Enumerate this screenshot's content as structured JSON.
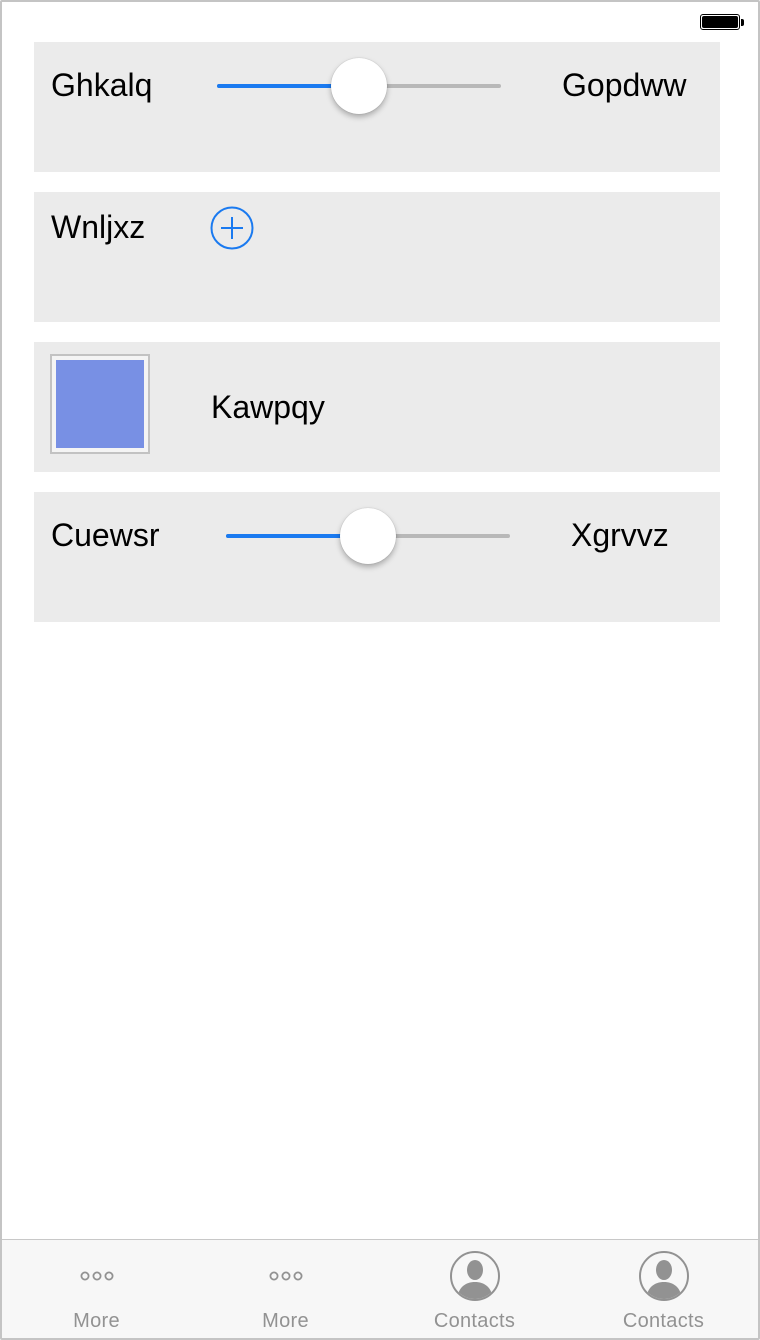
{
  "status_bar": {
    "battery_icon": "battery-full-icon"
  },
  "rows": [
    {
      "type": "slider",
      "min_label": "Ghkalq",
      "max_label": "Gopdww",
      "value": 0.5
    },
    {
      "type": "add",
      "label": "Wnljxz",
      "icon": "plus-circle-icon"
    },
    {
      "type": "color",
      "label": "Kawpqy",
      "color": "#7890e4"
    },
    {
      "type": "slider",
      "min_label": "Cuewsr",
      "max_label": "Xgrvvz",
      "value": 0.5
    }
  ],
  "tab_bar": {
    "items": [
      {
        "label": "More",
        "icon": "more-dots-icon"
      },
      {
        "label": "More",
        "icon": "more-dots-icon"
      },
      {
        "label": "Contacts",
        "icon": "contact-person-icon"
      },
      {
        "label": "Contacts",
        "icon": "contact-person-icon"
      }
    ]
  },
  "colors": {
    "accent": "#1a7af0",
    "card_background": "#ebebeb",
    "track_inactive": "#b8b8b8",
    "tab_inactive": "#929292"
  }
}
